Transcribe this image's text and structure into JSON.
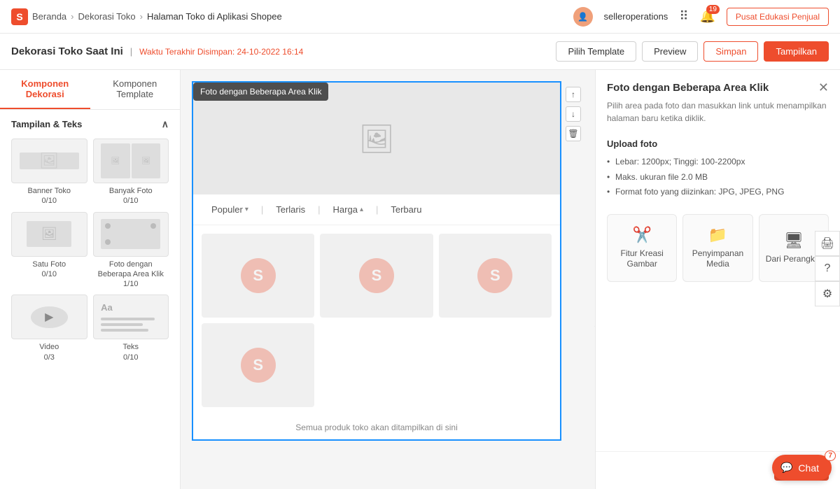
{
  "topNav": {
    "logo": "S",
    "breadcrumbs": [
      "Beranda",
      "Dekorasi Toko",
      "Halaman Toko di Aplikasi Shopee"
    ],
    "username": "selleroperations",
    "bell_count": "19",
    "pusat_label": "Pusat Edukasi Penjual"
  },
  "toolbar": {
    "title": "Dekorasi Toko Saat Ini",
    "time_label": "Waktu Terakhir Disimpan: 24-10-2022 16:14",
    "btn_template": "Pilih Template",
    "btn_preview": "Preview",
    "btn_simpan": "Simpan",
    "btn_tampilkan": "Tampilkan"
  },
  "sidebar": {
    "tab1": "Komponen Dekorasi",
    "tab2": "Komponen Template",
    "section_title": "Tampilan & Teks",
    "items": [
      {
        "label": "Banner Toko",
        "count": "0/10",
        "type": "banner"
      },
      {
        "label": "Banyak Foto",
        "count": "0/10",
        "type": "many-photo"
      },
      {
        "label": "Satu Foto",
        "count": "0/10",
        "type": "single-photo"
      },
      {
        "label": "Foto dengan Beberapa Area Klik",
        "count": "1/10",
        "type": "multi-click"
      },
      {
        "label": "Video",
        "count": "0/3",
        "type": "video"
      },
      {
        "label": "Teks",
        "count": "0/10",
        "type": "text"
      }
    ]
  },
  "tooltip": "Foto dengan Beberapa Area Klik",
  "filterTabs": [
    "Populer",
    "Terlaris",
    "Harga",
    "Terbaru"
  ],
  "productCaption": "Semua produk toko akan ditampilkan di sini",
  "rightPanel": {
    "title": "Foto dengan Beberapa Area Klik",
    "desc": "Pilih area pada foto dan masukkan link untuk menampilkan halaman baru ketika diklik.",
    "upload_title": "Upload foto",
    "rules": [
      "Lebar: 1200px; Tinggi: 100-2200px",
      "Maks. ukuran file 2.0 MB",
      "Format foto yang diizinkan: JPG, JPEG, PNG"
    ],
    "option1": "Fitur Kreasi Gambar",
    "option2": "Penyimpanan Media",
    "option3": "Dari Perangkat",
    "btn_simpan": "Simpan"
  },
  "chat": {
    "label": "Chat",
    "count": "7"
  }
}
